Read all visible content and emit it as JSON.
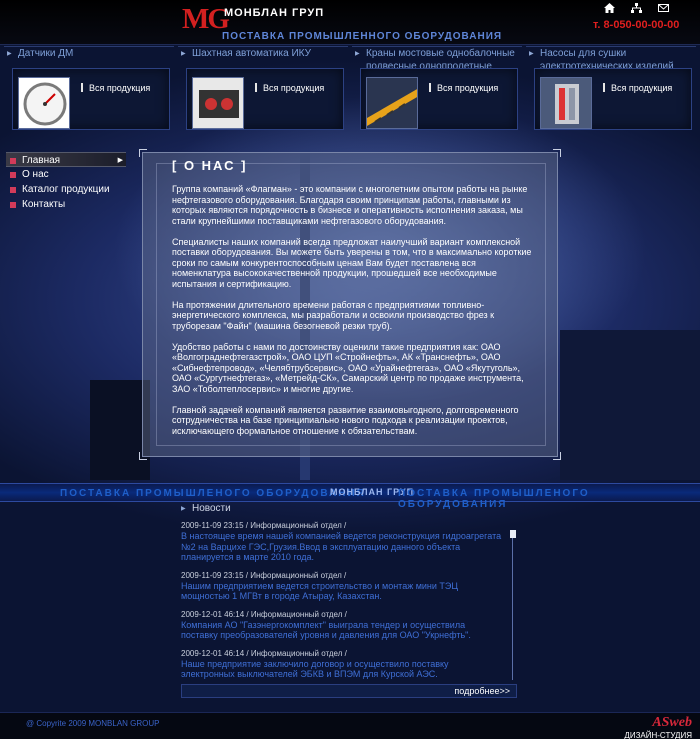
{
  "header": {
    "logo_mark": "MG",
    "logo_name": "МОНБЛАН ГРУП",
    "tagline": "ПОСТАВКА ПРОМЫШЛЕННОГО ОБОРУДОВАНИЯ",
    "phone": "т. 8-050-00-00-00",
    "icons": [
      "home-icon",
      "sitemap-icon",
      "mail-icon"
    ]
  },
  "categories": [
    {
      "title": "Датчики ДМ",
      "link": "Вся продукция"
    },
    {
      "title": "Шахтная автоматика ИКУ",
      "link": "Вся продукция"
    },
    {
      "title": "Краны мостовые однобалочные подвесные однопролетные",
      "link": "Вся продукция"
    },
    {
      "title": "Насосы для сушки электротехнических изделий",
      "link": "Вся продукция"
    }
  ],
  "nav": [
    {
      "label": "Главная",
      "active": true
    },
    {
      "label": "О нас",
      "active": false
    },
    {
      "label": "Каталог продукции",
      "active": false
    },
    {
      "label": "Контакты",
      "active": false
    }
  ],
  "content": {
    "title": "[ О НАС ]",
    "paragraphs": [
      "Группа компаний «Флагман» - это компании с многолетним опытом работы на рынке нефтегазового оборудования. Благодаря своим принципам работы, главными из которых являются порядочность в бизнесе и оперативность исполнения заказа, мы стали крупнейшими поставщиками нефтегазового оборудования.",
      "Специалисты наших компаний всегда предложат наилучший вариант комплексной поставки оборудования. Вы можете быть уверены в том, что в максимально короткие сроки по самым конкурентоспособным ценам Вам будет поставлена вся номенклатура высококачественной продукции, прошедшей все необходимые испытания и сертификацию.",
      "На протяжении длительного времени работая с предприятиями топливно-энергетического комплекса, мы разработали и освоили производство фрез к труборезам \"Файн\" (машина безогневой резки труб).",
      "Удобство работы с нами по достоинству оценили такие предприятия как: ОАО «Волгограднефтегазстрой», ОАО ЦУП «Стройнефть», АК «Транснефть», ОАО «Сибнефтепровод», «Челябтрубсервис», ОАО «Урайнефтегаз», ОАО «Якутуголь», ОАО «Сургутнефтегаз», «Метрейд-СК», Самарский центр по продаже инструмента, ЗАО «Тоболтеплосервис» и многие другие.",
      "Главной задачей компаний является развитие взаимовыгодного, долговременного сотрудничества на базе принципиально нового подхода к реализации проектов, исключающего формальное отношение к обязательствам."
    ]
  },
  "band": {
    "left_text": "ПОСТАВКА ПРОМЫШЛЕНОГО ОБОРУДОВАНИЯ",
    "logo": "МОНБЛАН ГРУП",
    "right_text": "ПОСТАВКА ПРОМЫШЛЕНОГО ОБОРУДОВАНИЯ"
  },
  "news": {
    "title": "Новости",
    "items": [
      {
        "meta": "2009-11-09 23:15 / Информационный отдел /",
        "text": "В настоящее время нашей компанией ведется реконструкция гидроагрегата №2 на Варцихе ГЭС,Грузия.Ввод в эксплуатацию данного объекта планируется в марте 2010 года."
      },
      {
        "meta": "2009-11-09 23:15 / Информационный отдел /",
        "text": "Нашим предприятием ведется строительство и монтаж мини ТЭЦ мощностью 1 МГВт в городе Атырау, Казахстан."
      },
      {
        "meta": "2009-12-01 46:14 / Информационный отдел /",
        "text": "Компания АО \"Газэнергокомплект\" выиграла тендер и осуществила поставку преобразователей уровня и давления для ОАО \"Укрнефть\"."
      },
      {
        "meta": "2009-12-01 46:14 / Информационный отдел /",
        "text": "Наше предприятие заключило договор и осуществило поставку электронных выключателей ЭБКВ и ВПЭМ для Курской АЭС."
      }
    ],
    "more": "подробнее>>"
  },
  "footer": {
    "copyright": "@ Copyrite 2009   MONBLAN GROUP",
    "studio_mark": "ASweb",
    "studio_sub": "ДИЗАЙН-СТУДИЯ"
  }
}
